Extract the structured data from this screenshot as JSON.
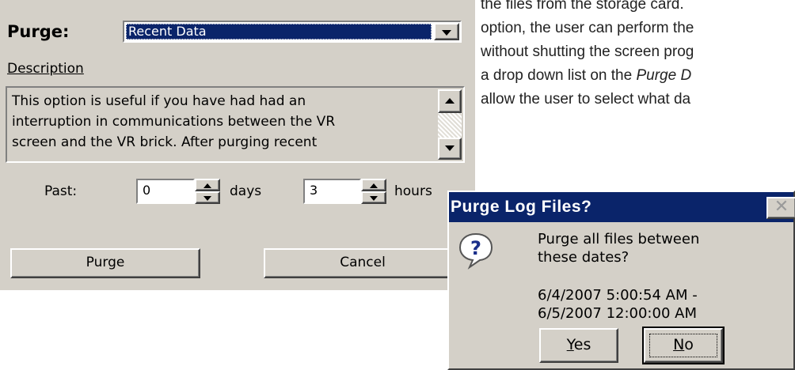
{
  "doc": {
    "lines": [
      "the files from the storage card.",
      "option, the user can perform the",
      "without shutting the screen prog",
      "a drop down list on the",
      "Purge D",
      "allow the user to select what da"
    ]
  },
  "purge_dialog": {
    "purge_label": "Purge:",
    "purge_option": "Recent Data",
    "description_label": "Description",
    "description_lines": [
      "This option is useful if you have had had an",
      "interruption in communications between the VR",
      "screen and the VR brick.   After purging recent"
    ],
    "past_label": "Past:",
    "days_value": "0",
    "days_label": "days",
    "hours_value": "3",
    "hours_label": "hours",
    "purge_button": "Purge",
    "cancel_button": "Cancel"
  },
  "message_box": {
    "title": "Purge Log Files?",
    "close_glyph": "✕",
    "question_glyph": "?",
    "message_lines": [
      "Purge all files between",
      "these dates?"
    ],
    "date_lines": [
      "6/4/2007 5:00:54 AM -",
      "6/5/2007 12:00:00 AM"
    ],
    "yes_hotkey": "Y",
    "yes_rest": "es",
    "no_hotkey": "N",
    "no_rest": "o"
  },
  "colors": {
    "dialog_bg": "#d4d0c8",
    "selection_bg": "#0a246a",
    "question_icon": "#1a2f8a"
  }
}
